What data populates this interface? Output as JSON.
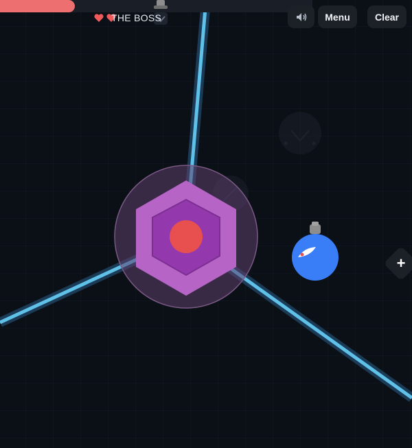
{
  "hud": {
    "boss_health_fraction": 0.24,
    "boss_label": "THE BOSS",
    "lives": 2,
    "sound_icon": "speaker-icon",
    "menu_label": "Menu",
    "clear_label": "Clear",
    "add_label": "+"
  },
  "colors": {
    "background": "#0b0f16",
    "grid": "#161c26",
    "laser": "#5fc0e8",
    "laser_glow": "#2a5f8a",
    "hexagon_outer": "#b665c6",
    "hexagon_inner": "#9438ad",
    "core": "#e8504f",
    "aura": "#5e3f6e",
    "player": "#3a7ef7",
    "health_fill": "#ee6f6f",
    "heart": "#ef5a5a"
  },
  "entities": {
    "boss": {
      "type": "hexagon-core"
    },
    "player": {
      "type": "blue-orb",
      "has_cap": true
    },
    "ghost_marker": {
      "type": "chevron-shield"
    },
    "lasers": 3
  }
}
